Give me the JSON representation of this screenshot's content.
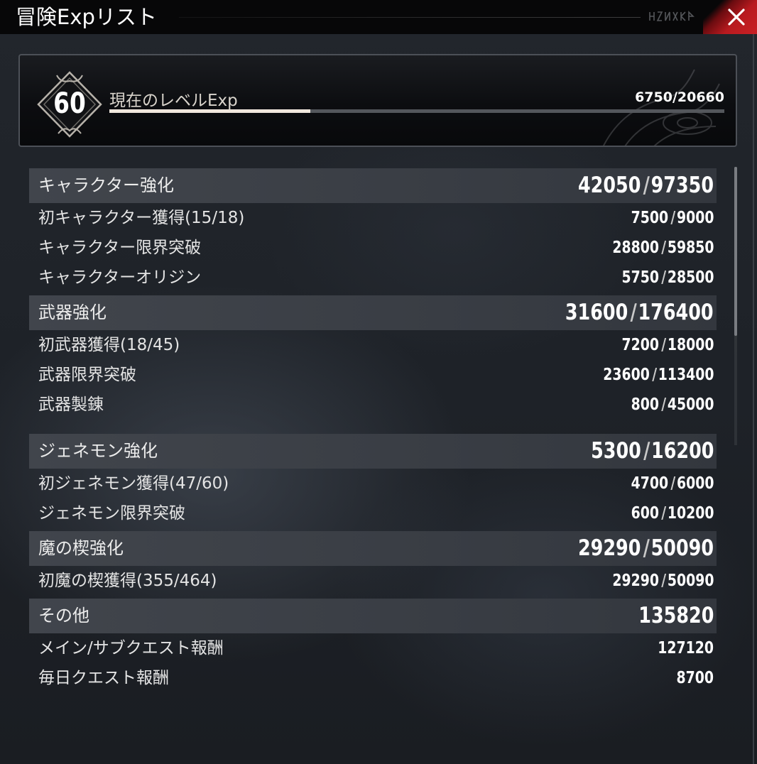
{
  "window": {
    "title": "冒険Expリスト"
  },
  "level": {
    "number": "60",
    "label": "現在のレベルExp",
    "current": "6750",
    "max": "20660",
    "value_text": "6750/20660",
    "progress": 0.327
  },
  "colors": {
    "header_bg": "#3d4148",
    "close_red": "#c92025",
    "bar_fill": "#f1e8de"
  },
  "sections": [
    {
      "title": "キャラクター強化",
      "current": "42050",
      "max": "97350",
      "items": [
        {
          "label": "初キャラクター獲得(15/18)",
          "current": "7500",
          "max": "9000"
        },
        {
          "label": "キャラクター限界突破",
          "current": "28800",
          "max": "59850"
        },
        {
          "label": "キャラクターオリジン",
          "current": "5750",
          "max": "28500"
        }
      ]
    },
    {
      "title": "武器強化",
      "current": "31600",
      "max": "176400",
      "items": [
        {
          "label": "初武器獲得(18/45)",
          "current": "7200",
          "max": "18000"
        },
        {
          "label": "武器限界突破",
          "current": "23600",
          "max": "113400"
        },
        {
          "label": "武器製錬",
          "current": "800",
          "max": "45000"
        }
      ]
    },
    {
      "title": "ジェネモン強化",
      "current": "5300",
      "max": "16200",
      "items": [
        {
          "label": "初ジェネモン獲得(47/60)",
          "current": "4700",
          "max": "6000"
        },
        {
          "label": "ジェネモン限界突破",
          "current": "600",
          "max": "10200"
        }
      ]
    },
    {
      "title": "魔の楔強化",
      "current": "29290",
      "max": "50090",
      "items": [
        {
          "label": "初魔の楔獲得(355/464)",
          "current": "29290",
          "max": "50090"
        }
      ]
    },
    {
      "title": "その他",
      "current": "135820",
      "items": [
        {
          "label": "メイン/サブクエスト報酬",
          "current": "127120"
        },
        {
          "label": "毎日クエスト報酬",
          "current": "8700"
        }
      ]
    }
  ]
}
